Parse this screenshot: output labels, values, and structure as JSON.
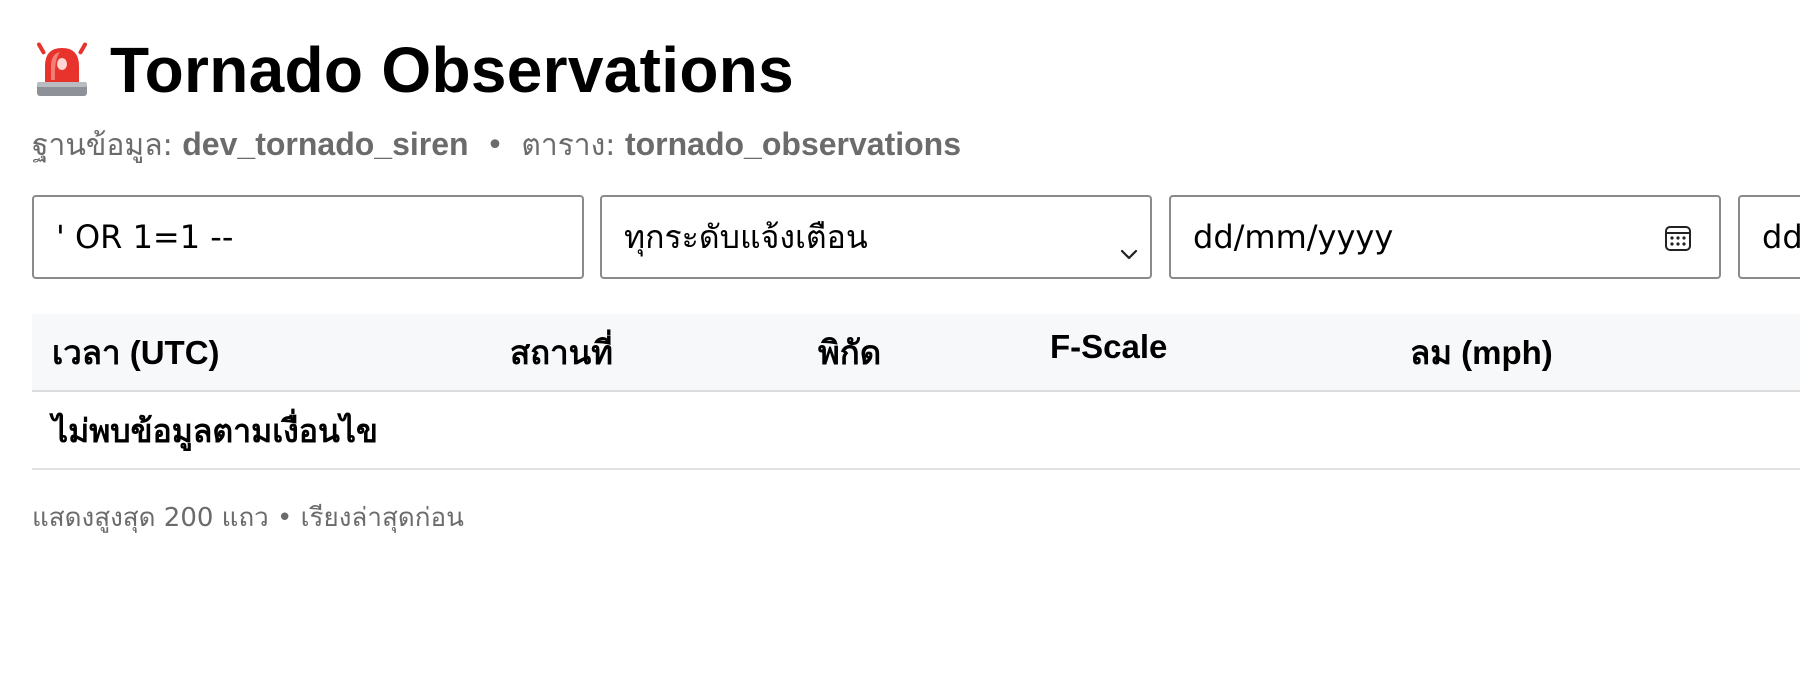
{
  "header": {
    "icon": "police-siren-icon",
    "title": "Tornado Observations"
  },
  "subtitle": {
    "db_label": "ฐานข้อมูล:",
    "db_name": "dev_tornado_siren",
    "separator": "•",
    "table_label": "ตาราง:",
    "table_name": "tornado_observations"
  },
  "filters": {
    "search_value": "' OR 1=1 --",
    "level_selected": "ทุกระดับแจ้งเตือน",
    "date_from_placeholder": "dd/mm/yyyy",
    "date_to_placeholder": "dd/mm/yyyy"
  },
  "table": {
    "columns": [
      "เวลา (UTC)",
      "สถานที่",
      "พิกัด",
      "F-Scale",
      "ลม (mph)"
    ],
    "empty_message": "ไม่พบข้อมูลตามเงื่อนไข"
  },
  "footer": {
    "note": "แสดงสูงสุด 200 แถว • เรียงล่าสุดก่อน"
  },
  "colors": {
    "muted_text": "#6b6b6b",
    "header_bg": "#f7f8fa",
    "border": "#8a8a8a",
    "siren_red": "#e8322c"
  }
}
